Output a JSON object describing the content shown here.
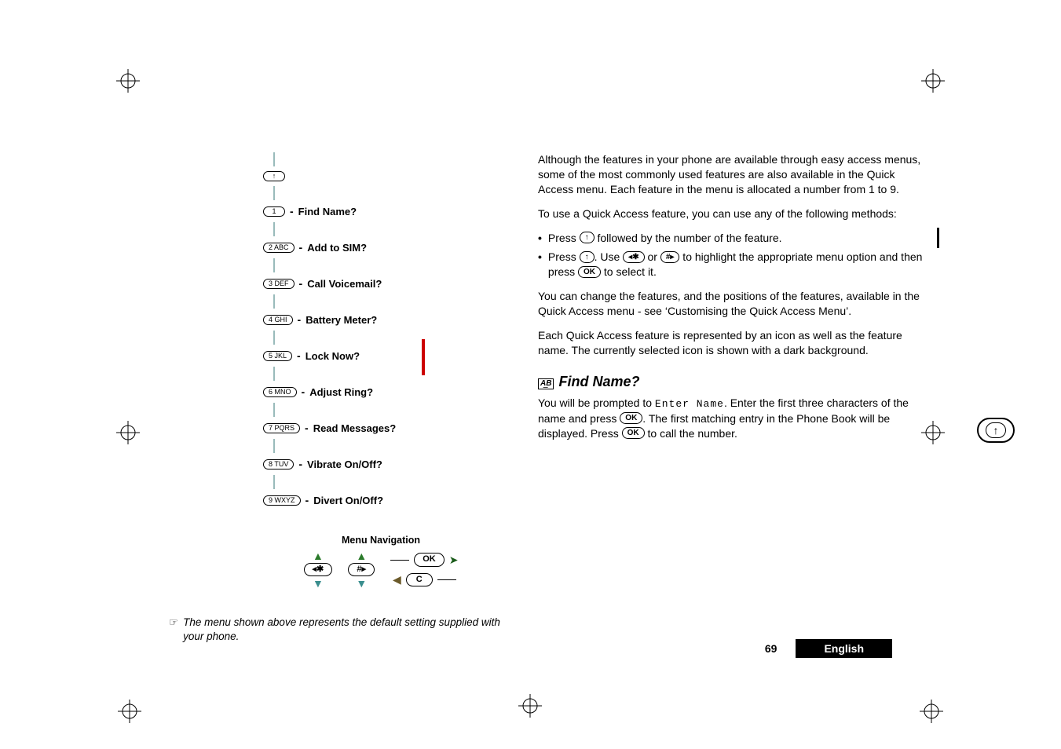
{
  "menu": {
    "items": [
      {
        "key": "1",
        "label": "Find Name?"
      },
      {
        "key": "2 ABC",
        "label": "Add to SIM?"
      },
      {
        "key": "3 DEF",
        "label": "Call Voicemail?"
      },
      {
        "key": "4 GHI",
        "label": "Battery Meter?"
      },
      {
        "key": "5 JKL",
        "label": "Lock Now?"
      },
      {
        "key": "6 MNO",
        "label": "Adjust Ring?"
      },
      {
        "key": "7 PQRS",
        "label": "Read Messages?"
      },
      {
        "key": "8 TUV",
        "label": "Vibrate On/Off?"
      },
      {
        "key": "9 WXYZ",
        "label": "Divert On/Off?"
      }
    ],
    "top_key_glyph": "↑"
  },
  "nav": {
    "heading": "Menu Navigation",
    "keys": {
      "star": "✱",
      "hash": "#",
      "ok": "OK",
      "c": "C"
    }
  },
  "note": {
    "icon": "☞",
    "text": "The menu shown above represents the default setting supplied with your phone."
  },
  "body": {
    "p1": "Although the features in your phone are available through easy access menus, some of the most commonly used features are also available in the Quick Access menu. Each feature in the menu is allocated a number from 1 to 9.",
    "p2": "To use a Quick Access feature, you can use any of the following methods:",
    "b1_pre": "Press ",
    "b1_key": "↑",
    "b1_post": " followed by the number of the feature.",
    "b2_pre": "Press ",
    "b2_key1": "↑",
    "b2_mid1": ". Use ",
    "b2_key2": "✱",
    "b2_mid2": " or ",
    "b2_key3": "#",
    "b2_mid3": " to highlight the appropriate menu option and then press ",
    "b2_key4": "OK",
    "b2_post": " to select it.",
    "p3": "You can change the features, and the positions of the features, available in the Quick Access menu - see ‘Customising the Quick Access Menu’.",
    "p4": "Each Quick Access feature is represented by an icon as well as the feature name. The currently selected icon is shown with a dark background.",
    "feature_icon": "A͟B",
    "feature_title": "Find Name?",
    "p5_pre": "You will be prompted to ",
    "p5_lcd": "Enter Name",
    "p5_mid1": ". Enter the first three characters of the name and press ",
    "p5_key1": "OK",
    "p5_mid2": ". The first matching entry in the Phone Book will be displayed. Press ",
    "p5_key2": "OK",
    "p5_post": " to call the number."
  },
  "margin_badge": "↑",
  "footer": {
    "page": "69",
    "lang": "English"
  }
}
